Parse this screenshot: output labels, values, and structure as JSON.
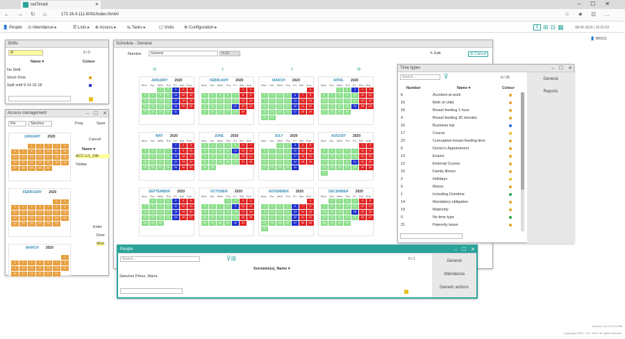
{
  "browser": {
    "tab_title": "netTime6",
    "url": "172.16.4.111:6091/index.html#/"
  },
  "menu": {
    "items": [
      "People",
      "Attendance",
      "Lists",
      "Access",
      "Tasks",
      "Visits",
      "Configuration"
    ],
    "datetime": "08-05-2020 | 10:01:52",
    "user": "BIBISS",
    "badge": "5"
  },
  "shifts": {
    "title": "Shifts",
    "filter": "M",
    "count": "0 / 0",
    "col_name": "Name",
    "col_colour": "Colour",
    "rows": [
      {
        "name": "No Shift",
        "color": ""
      },
      {
        "name": "Short-Time",
        "color": "#e8a020"
      },
      {
        "name": "Split shift 9-14 15-18",
        "color": "#2233cc"
      }
    ]
  },
  "access": {
    "title": "Access management",
    "sel1": "Per.",
    "sel2": "Sánchez",
    "prop": "Prop",
    "save": "Save",
    "cancel": "Cancel",
    "col_name": "Name",
    "rows": [
      "ACC-L/1_24h",
      "Visitas"
    ],
    "tree": [
      "Entel",
      "Door",
      "dSel"
    ],
    "months": [
      {
        "name": "JANUARY",
        "year": "2020"
      },
      {
        "name": "FEBRUARY",
        "year": "2020"
      },
      {
        "name": "MARCH",
        "year": "2020"
      }
    ]
  },
  "schedule": {
    "title": "Schedule - General",
    "name_label": "Nombre",
    "name_value": "General",
    "code": "H-03",
    "edit": "Edit",
    "cancel": "Cancel",
    "days": [
      "Mon",
      "Tue",
      "Wed",
      "Thu",
      "Fri",
      "Sat",
      "Sun"
    ],
    "months": [
      {
        "name": "JANUARY",
        "year": "2020"
      },
      {
        "name": "FEBRUARY",
        "year": "2020"
      },
      {
        "name": "MARCH",
        "year": "2020"
      },
      {
        "name": "APRIL",
        "year": "2020"
      },
      {
        "name": "MAY",
        "year": "2020"
      },
      {
        "name": "JUNE",
        "year": "2020"
      },
      {
        "name": "JULY",
        "year": "2020"
      },
      {
        "name": "AUGUST",
        "year": "2020"
      },
      {
        "name": "SEPTEMBER",
        "year": "2020"
      },
      {
        "name": "OCTOBER",
        "year": "2020"
      },
      {
        "name": "NOVEMBER",
        "year": "2020"
      },
      {
        "name": "DECEMBER",
        "year": "2020"
      }
    ]
  },
  "time_types": {
    "title": "Time types",
    "search": "Search...",
    "count": "0 / 29",
    "col_number": "Number",
    "col_name": "Name",
    "col_colour": "Colour",
    "side": [
      "General",
      "Reports"
    ],
    "rows": [
      {
        "n": "8",
        "name": "Accident at work",
        "c": "#e8a020"
      },
      {
        "n": "15",
        "name": "Birth of child",
        "c": "#e8a020"
      },
      {
        "n": "18",
        "name": "Breast feeding 1 hour",
        "c": "#e8a020"
      },
      {
        "n": "4",
        "name": "Breast feeding 30 minutes",
        "c": "#e8a020"
      },
      {
        "n": "16",
        "name": "Business trip",
        "c": "#2266dd"
      },
      {
        "n": "17",
        "name": "Course",
        "c": "#e8c020"
      },
      {
        "n": "22",
        "name": "Cumulative breast feeding time",
        "c": "#e8a020"
      },
      {
        "n": "6",
        "name": "Doctor's Appointment",
        "c": "#e8a020"
      },
      {
        "n": "13",
        "name": "Exams",
        "c": "#e8a020"
      },
      {
        "n": "12",
        "name": "External Course",
        "c": "#e8a020"
      },
      {
        "n": "10",
        "name": "Family illness",
        "c": "#e8a020"
      },
      {
        "n": "2",
        "name": "Holidays",
        "c": "#e8c020"
      },
      {
        "n": "9",
        "name": "Illness",
        "c": "#e8a020"
      },
      {
        "n": "1",
        "name": "Including Overtime",
        "c": "#22aa44"
      },
      {
        "n": "14",
        "name": "Mandatory obligation",
        "c": "#e8a020"
      },
      {
        "n": "19",
        "name": "Maternity",
        "c": "#e8a020"
      },
      {
        "n": "0",
        "name": "No time type",
        "c": "#22aa44"
      },
      {
        "n": "21",
        "name": "Paternity leave",
        "c": "#e8a020"
      }
    ]
  },
  "people": {
    "title": "People",
    "search": "Search...",
    "count": "0 / 1",
    "col": "Surname(s), Name",
    "rows": [
      "Sánchez Pérez, María"
    ],
    "side": [
      "General",
      "Attendance",
      "Generic actions"
    ]
  },
  "footer": {
    "version": "Version: 6.0.17143.2356",
    "copyright": "Copyright SPEC, S.A. 2020. All rights reserved."
  }
}
